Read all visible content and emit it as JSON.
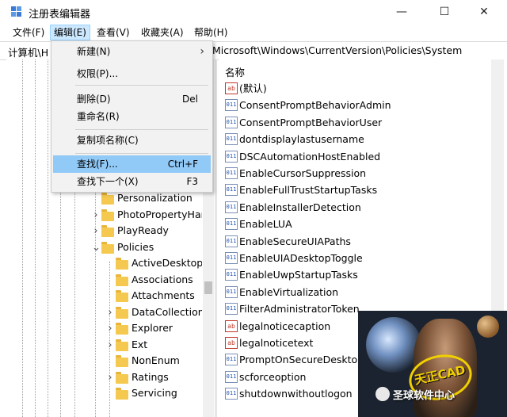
{
  "window": {
    "title": "注册表编辑器",
    "minimize": "—",
    "maximize": "☐",
    "close": "✕"
  },
  "menubar": [
    "文件(F)",
    "编辑(E)",
    "查看(V)",
    "收藏夹(A)",
    "帮助(H)"
  ],
  "address": {
    "left": "计算机\\H",
    "right": "Microsoft\\Windows\\CurrentVersion\\Policies\\System"
  },
  "edit_menu": {
    "items": [
      {
        "label": "新建(N)",
        "shortcut": "",
        "submenu": true
      },
      {
        "label": "权限(P)...",
        "shortcut": ""
      },
      {
        "label": "删除(D)",
        "shortcut": "Del"
      },
      {
        "label": "重命名(R)",
        "shortcut": ""
      },
      {
        "label": "复制项名称(C)",
        "shortcut": ""
      },
      {
        "label": "查找(F)...",
        "shortcut": "Ctrl+F",
        "highlighted": true
      },
      {
        "label": "查找下一个(X)",
        "shortcut": "F3"
      }
    ]
  },
  "tree": {
    "items": [
      {
        "label": "Personalization",
        "level": 1,
        "expandable": false
      },
      {
        "label": "PhotoPropertyHar",
        "level": 1,
        "expandable": true
      },
      {
        "label": "PlayReady",
        "level": 1,
        "expandable": true
      },
      {
        "label": "Policies",
        "level": 1,
        "expandable": true,
        "expanded": true
      },
      {
        "label": "ActiveDesktop",
        "level": 2,
        "expandable": false
      },
      {
        "label": "Associations",
        "level": 2,
        "expandable": false
      },
      {
        "label": "Attachments",
        "level": 2,
        "expandable": false
      },
      {
        "label": "DataCollection",
        "level": 2,
        "expandable": true
      },
      {
        "label": "Explorer",
        "level": 2,
        "expandable": true
      },
      {
        "label": "Ext",
        "level": 2,
        "expandable": true
      },
      {
        "label": "NonEnum",
        "level": 2,
        "expandable": false
      },
      {
        "label": "Ratings",
        "level": 2,
        "expandable": true
      },
      {
        "label": "Servicing",
        "level": 2,
        "expandable": false
      }
    ]
  },
  "values": {
    "column_name": "名称",
    "rows": [
      {
        "name": "(默认)",
        "type": "ab"
      },
      {
        "name": "ConsentPromptBehaviorAdmin",
        "type": "dword"
      },
      {
        "name": "ConsentPromptBehaviorUser",
        "type": "dword"
      },
      {
        "name": "dontdisplaylastusername",
        "type": "dword"
      },
      {
        "name": "DSCAutomationHostEnabled",
        "type": "dword"
      },
      {
        "name": "EnableCursorSuppression",
        "type": "dword"
      },
      {
        "name": "EnableFullTrustStartupTasks",
        "type": "dword"
      },
      {
        "name": "EnableInstallerDetection",
        "type": "dword"
      },
      {
        "name": "EnableLUA",
        "type": "dword"
      },
      {
        "name": "EnableSecureUIAPaths",
        "type": "dword"
      },
      {
        "name": "EnableUIADesktopToggle",
        "type": "dword"
      },
      {
        "name": "EnableUwpStartupTasks",
        "type": "dword"
      },
      {
        "name": "EnableVirtualization",
        "type": "dword"
      },
      {
        "name": "FilterAdministratorToken",
        "type": "dword"
      },
      {
        "name": "legalnoticecaption",
        "type": "ab"
      },
      {
        "name": "legalnoticetext",
        "type": "ab"
      },
      {
        "name": "PromptOnSecureDesktop",
        "type": "dword"
      },
      {
        "name": "scforceoption",
        "type": "dword"
      },
      {
        "name": "shutdownwithoutlogon",
        "type": "dword"
      }
    ]
  },
  "watermark": {
    "stamp": "天正CAD",
    "account": "圣球软件中心"
  },
  "colors": {
    "menu_highlight": "#91c9f7",
    "active_menu": "#cce8ff",
    "folder": "#f5c94f"
  }
}
